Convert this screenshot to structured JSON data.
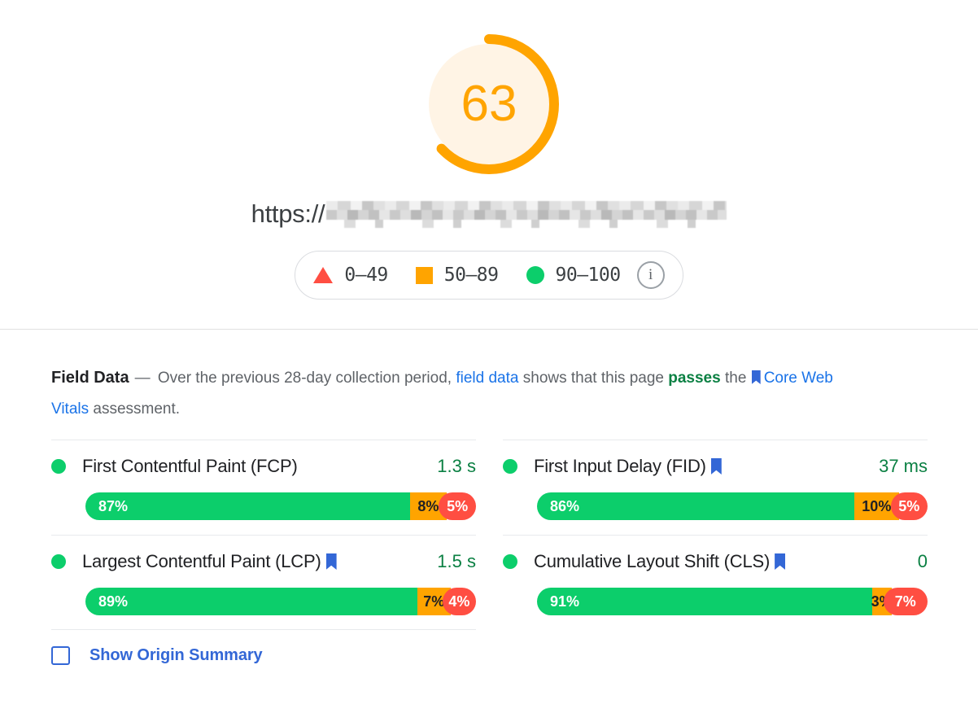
{
  "score": {
    "value": "63",
    "max": 100,
    "ring_color": "#ffa400",
    "track_color": "#fff4e5",
    "percent": 63
  },
  "url": {
    "scheme_text": "https://",
    "redacted": true
  },
  "legend": {
    "items": [
      {
        "icon": "triangle-red-icon",
        "label": "0–49",
        "color": "#ff4e42"
      },
      {
        "icon": "square-orange-icon",
        "label": "50–89",
        "color": "#ffa400"
      },
      {
        "icon": "circle-green-icon",
        "label": "90–100",
        "color": "#0cce6b"
      }
    ],
    "info_icon": "info-icon",
    "info_glyph": "i"
  },
  "field_data": {
    "title": "Field Data",
    "dash": "—",
    "desc_part1": "Over the previous 28-day collection period,",
    "link_field_data": "field data",
    "desc_part2": "shows that this page",
    "passes": "passes",
    "desc_part3": "the",
    "link_core_web_vitals": "Core Web Vitals",
    "desc_part4": "assessment.",
    "metrics": [
      {
        "name": "First Contentful Paint (FCP)",
        "has_bookmark": false,
        "status": "good",
        "value": "1.3 s",
        "good_pct": 87,
        "avg_pct": 8,
        "poor_pct": 5,
        "good_label": "87%",
        "avg_label": "8%",
        "poor_label": "5%"
      },
      {
        "name": "First Input Delay (FID)",
        "has_bookmark": true,
        "status": "good",
        "value": "37 ms",
        "good_pct": 86,
        "avg_pct": 10,
        "poor_pct": 5,
        "good_label": "86%",
        "avg_label": "10%",
        "poor_label": "5%"
      },
      {
        "name": "Largest Contentful Paint (LCP)",
        "has_bookmark": true,
        "status": "good",
        "value": "1.5 s",
        "good_pct": 89,
        "avg_pct": 7,
        "poor_pct": 4,
        "good_label": "89%",
        "avg_label": "7%",
        "poor_label": "4%"
      },
      {
        "name": "Cumulative Layout Shift (CLS)",
        "has_bookmark": true,
        "status": "good",
        "value": "0",
        "good_pct": 91,
        "avg_pct": 3,
        "poor_pct": 7,
        "good_label": "91%",
        "avg_label": "3%",
        "poor_label": "7%"
      }
    ],
    "origin_summary": {
      "label": "Show Origin Summary",
      "checked": false
    }
  },
  "colors": {
    "good": "#0cce6b",
    "average": "#ffa400",
    "poor": "#ff4e42",
    "link": "#1a73e8",
    "pass": "#0b8043",
    "value_text": "#0b8043",
    "bookmark": "#3367d6"
  }
}
